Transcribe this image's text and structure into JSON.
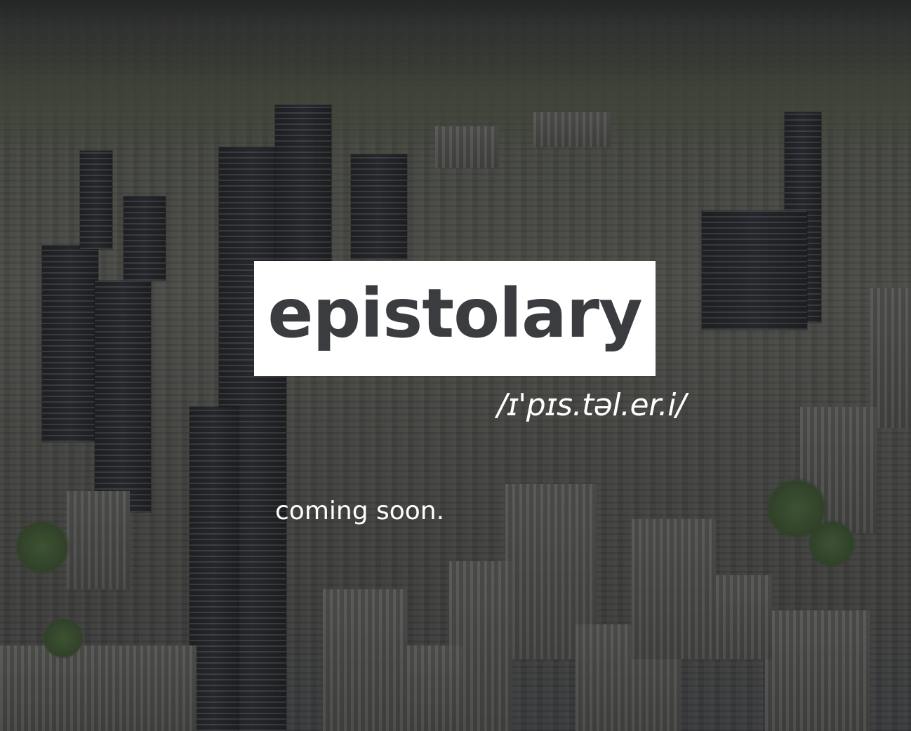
{
  "page": {
    "background_image": "aerial-city-skyline",
    "overlay_color": "#141416"
  },
  "brand": {
    "name": "epistolary",
    "pronunciation": "/ɪ'pɪs.təl.er.i/",
    "box_color": "#ffffff",
    "text_color": "#3b3c40"
  },
  "status": {
    "tagline": "coming soon."
  }
}
